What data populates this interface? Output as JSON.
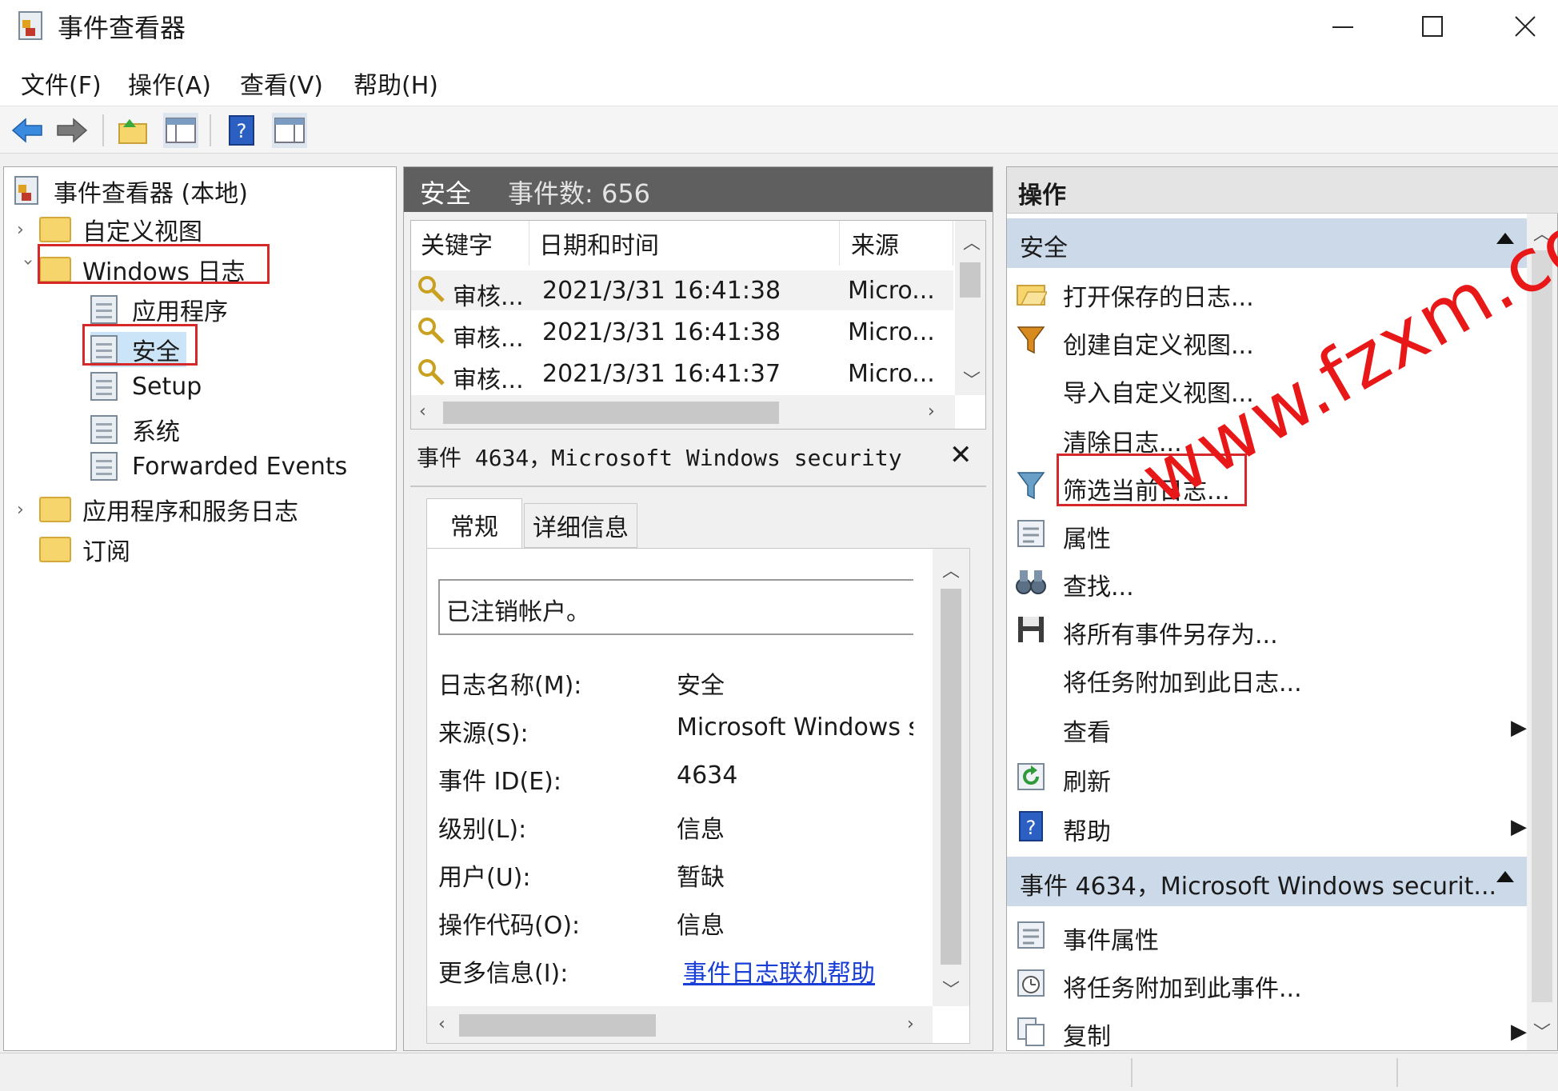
{
  "window": {
    "title": "事件查看器"
  },
  "menu": [
    "文件(F)",
    "操作(A)",
    "查看(V)",
    "帮助(H)"
  ],
  "tree": {
    "root": "事件查看器 (本地)",
    "custom_views": "自定义视图",
    "windows_logs": "Windows 日志",
    "application": "应用程序",
    "security": "安全",
    "setup": "Setup",
    "system": "系统",
    "forwarded": "Forwarded Events",
    "app_service_logs": "应用程序和服务日志",
    "subscriptions": "订阅"
  },
  "events": {
    "log_name": "安全",
    "count_label": "事件数: 656",
    "columns": [
      "关键字",
      "日期和时间",
      "来源"
    ],
    "rows": [
      {
        "keyword": "审核...",
        "datetime": "2021/3/31 16:41:38",
        "source": "Micro..."
      },
      {
        "keyword": "审核...",
        "datetime": "2021/3/31 16:41:38",
        "source": "Micro..."
      },
      {
        "keyword": "审核...",
        "datetime": "2021/3/31 16:41:37",
        "source": "Micro..."
      }
    ]
  },
  "detail": {
    "title": "事件 4634，Microsoft Windows security",
    "tabs": [
      "常规",
      "详细信息"
    ],
    "message": "已注销帐户。",
    "props": [
      {
        "label": "日志名称(M):",
        "value": "安全"
      },
      {
        "label": "来源(S):",
        "value": "Microsoft Windows se"
      },
      {
        "label": "事件 ID(E):",
        "value": "4634"
      },
      {
        "label": "级别(L):",
        "value": "信息"
      },
      {
        "label": "用户(U):",
        "value": "暂缺"
      },
      {
        "label": "操作代码(O):",
        "value": "信息"
      }
    ],
    "more_info_label": "更多信息(I):",
    "more_info_link": "事件日志联机帮助"
  },
  "actions": {
    "header": "操作",
    "section1": "安全",
    "items1": [
      "打开保存的日志...",
      "创建自定义视图...",
      "导入自定义视图...",
      "清除日志...",
      "筛选当前日志...",
      "属性",
      "查找...",
      "将所有事件另存为...",
      "将任务附加到此日志...",
      "查看",
      "刷新",
      "帮助"
    ],
    "section2": "事件 4634，Microsoft Windows securit...",
    "items2": [
      "事件属性",
      "将任务附加到此事件...",
      "复制"
    ]
  },
  "watermark": "www.fzxm.com",
  "colors": {
    "highlight_box": "#d62828",
    "section_bg": "#cbd9e8",
    "header_bg": "#5f5f5f",
    "link": "#1a3fd6",
    "watermark": "#e81818"
  }
}
